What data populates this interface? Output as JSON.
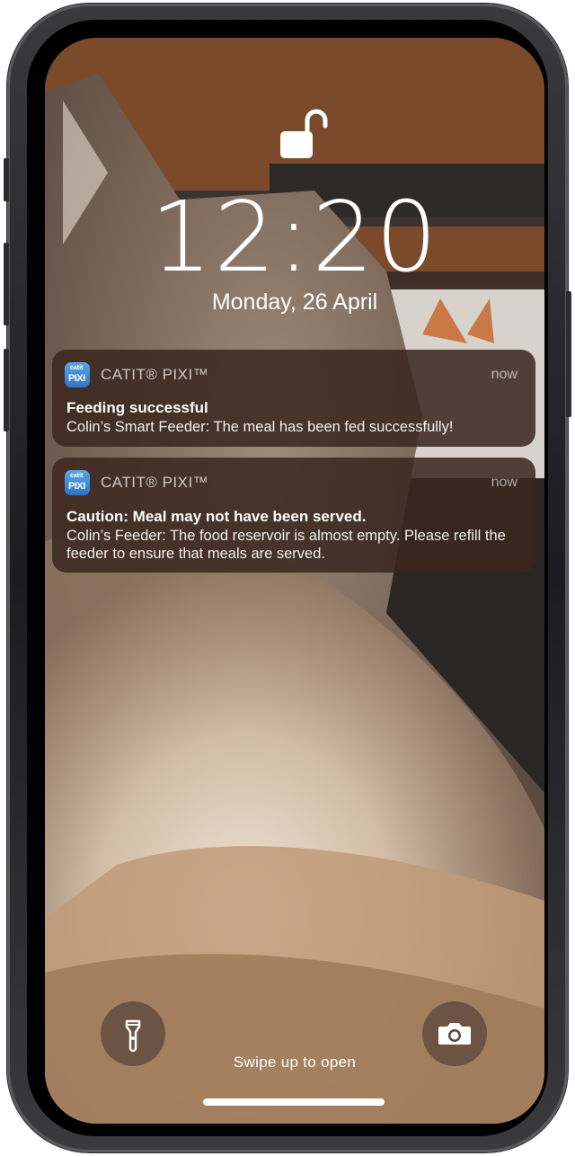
{
  "lockscreen": {
    "time": "12:20",
    "date": "Monday, 26 April",
    "swipe_hint": "Swipe up to open"
  },
  "notifications": [
    {
      "app_name": "CATIT® PIXI™",
      "app_icon_text_top": "catit",
      "app_icon_text_bottom": "PIXI",
      "time": "now",
      "title": "Feeding successful",
      "body": "Colin’s Smart Feeder: The meal has been fed successfully!"
    },
    {
      "app_name": "CATIT® PIXI™",
      "app_icon_text_top": "catit",
      "app_icon_text_bottom": "PIXI",
      "time": "now",
      "title": "Caution: Meal may not have been served.",
      "body": "Colin’s Feeder: The food reservoir is almost empty. Please refill the feeder to ensure that meals are served."
    }
  ],
  "icons": {
    "lock": "unlocked-padlock-icon",
    "flashlight": "flashlight-icon",
    "camera": "camera-icon"
  },
  "colors": {
    "app_icon": "#2f74c4",
    "notification_bg": "#3a261e"
  }
}
